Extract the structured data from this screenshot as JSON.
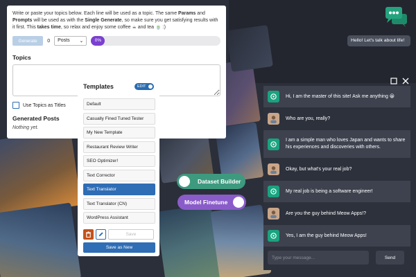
{
  "intro": {
    "p1": "Write or paste your topics below. Each line will be used as a topic. The same ",
    "b1": "Params",
    "p2": " and ",
    "b2": "Prompts",
    "p3": " will be used as with the ",
    "b3": "Single Generate",
    "p4": ", so make sure you get satisfying results with it first. This ",
    "b4": "takes time",
    "p5": ", so relax and enjoy some coffee ☕ and tea 🍵 :)"
  },
  "toolbar": {
    "generate_label": "Generate",
    "count": "0",
    "select_value": "Posts",
    "progress_label": "0%",
    "progress_percent": 0
  },
  "topics": {
    "title": "Topics",
    "value": "",
    "checkbox_label": "Use Topics as Titles"
  },
  "generated": {
    "title": "Generated Posts",
    "empty": "Nothing yet."
  },
  "templates": {
    "title": "Templates",
    "edit_label": "EDIT",
    "items": [
      {
        "label": "Default",
        "active": false
      },
      {
        "label": "Casually Fined Tuned Tester",
        "active": false
      },
      {
        "label": "My New Template",
        "active": false
      },
      {
        "label": "Restaurant Review Writer",
        "active": false
      },
      {
        "label": "SEO Optimizer!",
        "active": false
      },
      {
        "label": "Text Corrector",
        "active": false
      },
      {
        "label": "Text Translator",
        "active": true
      },
      {
        "label": "Text Translator (CN)",
        "active": false
      },
      {
        "label": "WordPress Assistant",
        "active": false
      }
    ],
    "save_label": "Save",
    "save_new_label": "Save as New"
  },
  "pills": {
    "dataset": "Dataset Builder",
    "finetune": "Model Finetune"
  },
  "chat": {
    "hello": "Hello! Let's talk about life!",
    "messages": [
      {
        "role": "bot",
        "text": "Hi, I am the master of this site! Ask me anything 😀"
      },
      {
        "role": "user",
        "text": "Who are you, really?"
      },
      {
        "role": "bot",
        "text": "I am a simple man who loves Japan and wants to share his experiences and discoveries with others."
      },
      {
        "role": "user",
        "text": "Okay, but what's your real job?"
      },
      {
        "role": "bot",
        "text": "My real job is being a software engineer!"
      },
      {
        "role": "user",
        "text": "Are you the guy behind Meow Apps!?"
      },
      {
        "role": "bot",
        "text": "Yes, I am the guy behind Meow Apps!"
      }
    ],
    "input_placeholder": "Type your message...",
    "send_label": "Send"
  },
  "colors": {
    "accent_blue": "#2f6db5",
    "progress_purple": "#7b3fd1",
    "dataset_green": "#3e9a7e",
    "finetune_purple": "#8a5cc9",
    "bot_green": "#19a37f",
    "chat_icon_green": "#25a37e"
  }
}
